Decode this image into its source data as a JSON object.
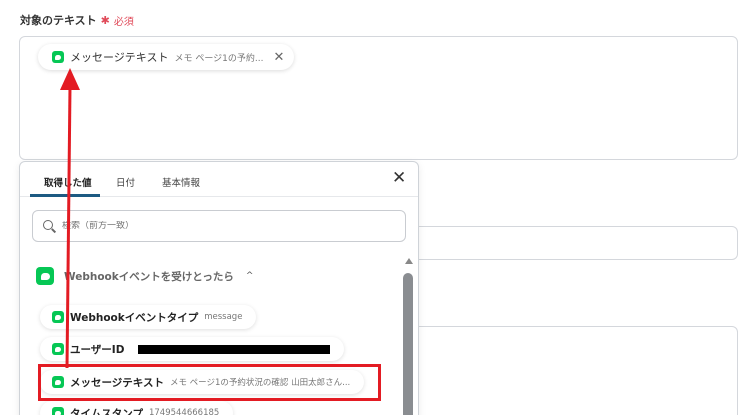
{
  "field": {
    "label": "対象のテキスト",
    "required_mark": "✱",
    "required_text": "必須"
  },
  "chip": {
    "label": "メッセージテキスト",
    "preview": "メモ ページ1の予約...",
    "close": "✕"
  },
  "panel": {
    "tabs": [
      "取得した値",
      "日付",
      "基本情報"
    ],
    "close": "✕",
    "search_placeholder": "検索（前方一致）",
    "group_label": "Webhookイベントを受けとったら",
    "group_caret": "^",
    "items": [
      {
        "label": "Webhookイベントタイプ",
        "value": "message"
      },
      {
        "label": "ユーザーID",
        "value": ""
      },
      {
        "label": "メッセージテキスト",
        "value": "メモ ページ1の予約状況の確認 山田太郎さん..."
      },
      {
        "label": "タイムスタンプ",
        "value": "1749544666185"
      }
    ]
  },
  "colors": {
    "line_green": "#06c755",
    "highlight_red": "#e31b23",
    "tab_underline": "#1d5a82"
  }
}
